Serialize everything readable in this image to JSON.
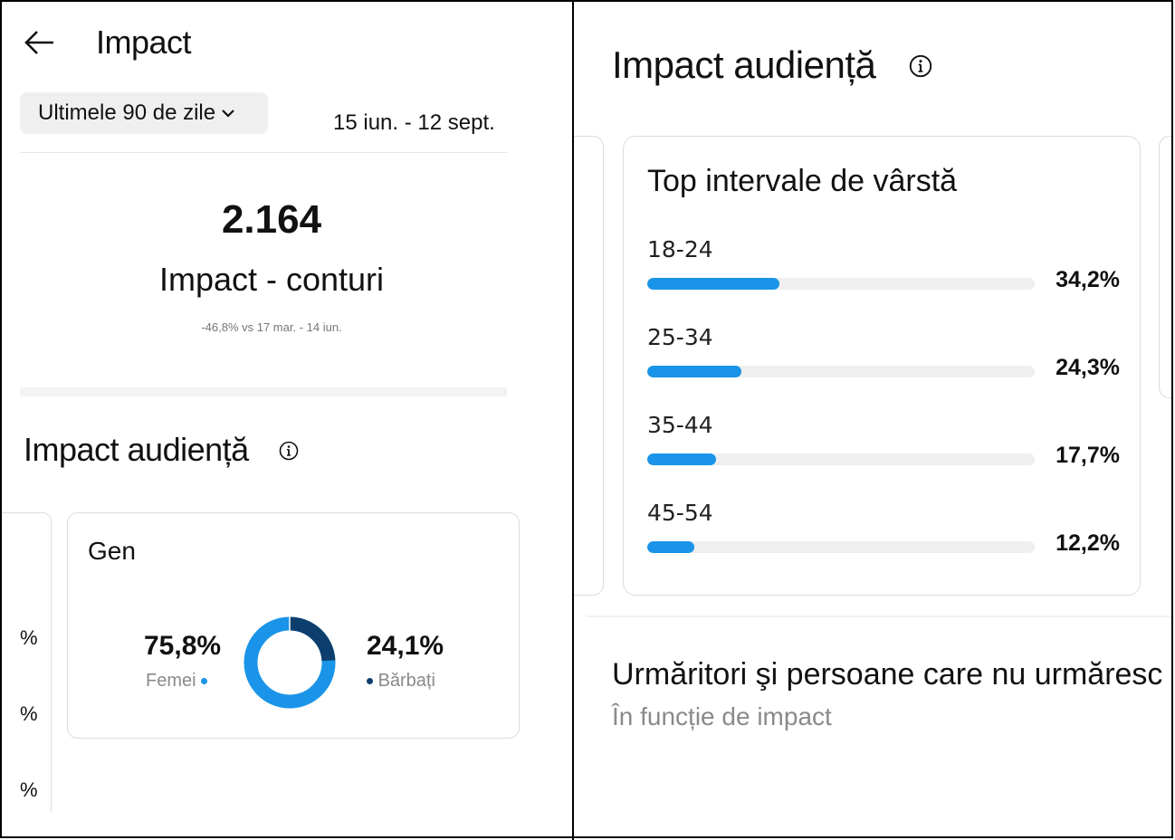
{
  "left_panel": {
    "header": {
      "title": "Impact",
      "back_icon": "arrow-left-icon"
    },
    "filter": {
      "range_label": "Ultimele 90 de zile",
      "date_range": "15 iun. - 12 sept."
    },
    "summary": {
      "value": "2.164",
      "label": "Impact - conturi",
      "comparison": "-46,8% vs 17 mar. - 14 iun."
    },
    "audience": {
      "title": "Impact audiență",
      "cut_off_values": [
        "%",
        "%",
        "%"
      ],
      "gender_card": {
        "title": "Gen",
        "female": {
          "value": "75,8%",
          "label": "Femei",
          "fraction": 0.758,
          "color": "#1a94e8"
        },
        "male": {
          "value": "24,1%",
          "label": "Bărbați",
          "fraction": 0.241,
          "color": "#0d3f6e"
        }
      }
    }
  },
  "right_panel": {
    "audience_title": "Impact audiență",
    "age_card": {
      "title": "Top intervale de vârstă",
      "rows": [
        {
          "label": "18-24",
          "value": "34,2%",
          "fraction": 0.342
        },
        {
          "label": "25-34",
          "value": "24,3%",
          "fraction": 0.243
        },
        {
          "label": "35-44",
          "value": "17,7%",
          "fraction": 0.177
        },
        {
          "label": "45-54",
          "value": "12,2%",
          "fraction": 0.122
        }
      ]
    },
    "followers": {
      "title": "Urmăritori şi persoane care nu urmăresc",
      "subtitle": "În funcție de impact"
    }
  },
  "colors": {
    "accent": "#1a94e8",
    "dark_accent": "#0d3f6e",
    "track": "#efefef"
  }
}
